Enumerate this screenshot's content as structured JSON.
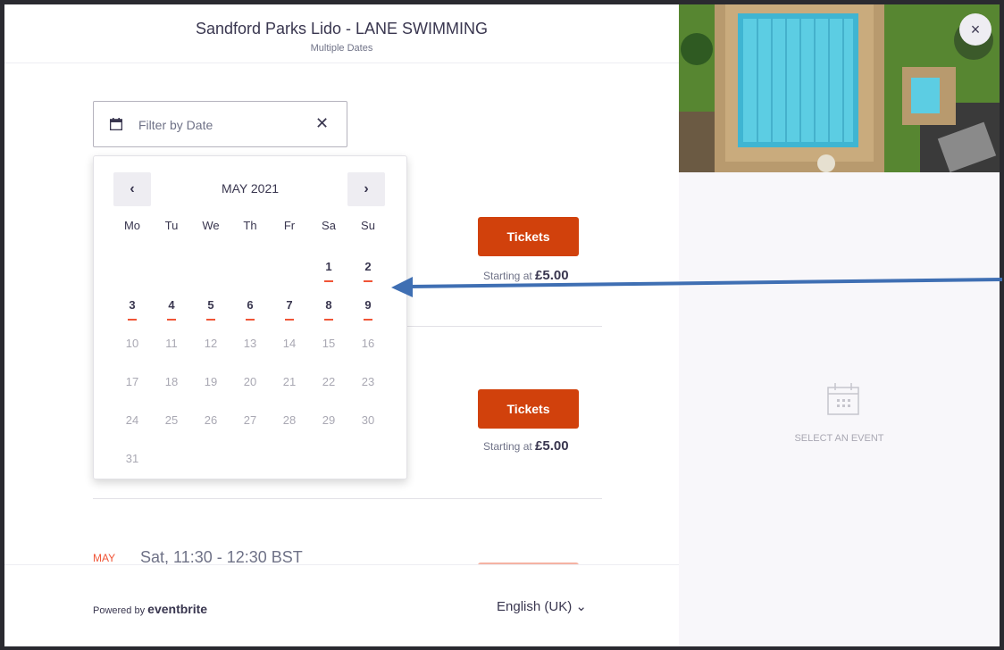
{
  "header": {
    "title": "Sandford Parks Lido - LANE SWIMMING",
    "subtitle": "Multiple Dates"
  },
  "filter": {
    "placeholder": "Filter by Date",
    "clear_icon": "✕",
    "calendar_icon": "calendar-icon"
  },
  "calendar": {
    "month_label": "MAY 2021",
    "prev_label": "‹",
    "next_label": "›",
    "weekdays": [
      "Mo",
      "Tu",
      "We",
      "Th",
      "Fr",
      "Sa",
      "Su"
    ],
    "leading_blanks": 5,
    "days": [
      {
        "label": "1",
        "available": true
      },
      {
        "label": "2",
        "available": true
      },
      {
        "label": "3",
        "available": true
      },
      {
        "label": "4",
        "available": true
      },
      {
        "label": "5",
        "available": true
      },
      {
        "label": "6",
        "available": true
      },
      {
        "label": "7",
        "available": true
      },
      {
        "label": "8",
        "available": true
      },
      {
        "label": "9",
        "available": true
      },
      {
        "label": "10",
        "available": false
      },
      {
        "label": "11",
        "available": false
      },
      {
        "label": "12",
        "available": false
      },
      {
        "label": "13",
        "available": false
      },
      {
        "label": "14",
        "available": false
      },
      {
        "label": "15",
        "available": false
      },
      {
        "label": "16",
        "available": false
      },
      {
        "label": "17",
        "available": false
      },
      {
        "label": "18",
        "available": false
      },
      {
        "label": "19",
        "available": false
      },
      {
        "label": "20",
        "available": false
      },
      {
        "label": "21",
        "available": false
      },
      {
        "label": "22",
        "available": false
      },
      {
        "label": "23",
        "available": false
      },
      {
        "label": "24",
        "available": false
      },
      {
        "label": "25",
        "available": false
      },
      {
        "label": "26",
        "available": false
      },
      {
        "label": "27",
        "available": false
      },
      {
        "label": "28",
        "available": false
      },
      {
        "label": "29",
        "available": false
      },
      {
        "label": "30",
        "available": false
      },
      {
        "label": "31",
        "available": false
      }
    ]
  },
  "events": [
    {
      "button_label": "Tickets",
      "starting_label": "Starting at",
      "price": "£5.00"
    },
    {
      "button_label": "Tickets",
      "starting_label": "Starting at",
      "price": "£5.00"
    }
  ],
  "event3": {
    "month": "MAY",
    "time": "Sat, 11:30 - 12:30 BST"
  },
  "footer": {
    "powered_by": "Powered by",
    "brand": "eventbrite",
    "language": "English (UK)",
    "language_chevron": "⌄"
  },
  "side_panel": {
    "close_label": "×",
    "empty_text": "SELECT AN EVENT"
  },
  "colors": {
    "accent": "#d1410c",
    "underline": "#f05537",
    "annotation_arrow": "#3f6fb3"
  }
}
